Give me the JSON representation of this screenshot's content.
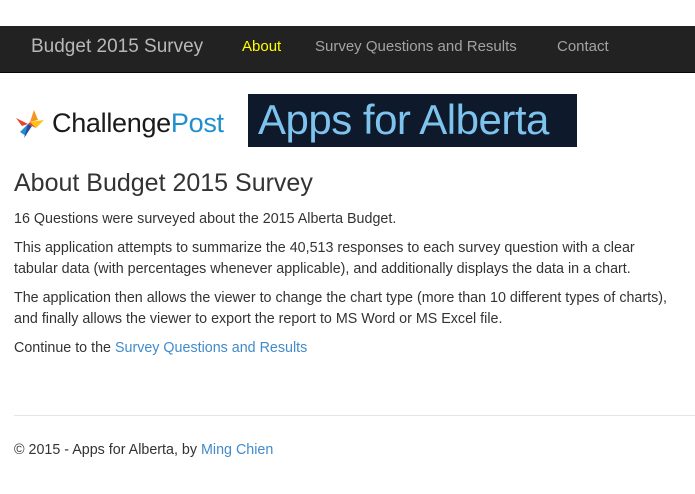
{
  "navbar": {
    "brand": "Budget 2015 Survey",
    "links": [
      {
        "label": "About",
        "active": true
      },
      {
        "label": "Survey Questions and Results",
        "active": false
      },
      {
        "label": "Contact",
        "active": false
      }
    ]
  },
  "logos": {
    "challengepost": {
      "part1": "Challenge",
      "part2": "Post"
    },
    "apps_for_alberta": "Apps for Alberta"
  },
  "main": {
    "title": "About Budget 2015 Survey",
    "para1": "16 Questions were surveyed about the 2015 Alberta Budget.",
    "para2": "This application attempts to summarize the 40,513 responses to each survey question with a clear tabular data (with percentages whenever applicable), and additionally displays the data in a chart.",
    "para3": "The application then allows the viewer to change the chart type (more than 10 different types of charts), and finally allows the viewer to export the report to MS Word or MS Excel file.",
    "continue_prefix": "Continue to the ",
    "continue_link": "Survey Questions and Results"
  },
  "footer": {
    "prefix": "© 2015 - Apps for Alberta, by ",
    "author_link": "Ming Chien"
  },
  "colors": {
    "navbar_bg": "#222222",
    "nav_active": "#ffff00",
    "link": "#428bca",
    "challengepost_blue": "#1f8fd0"
  }
}
